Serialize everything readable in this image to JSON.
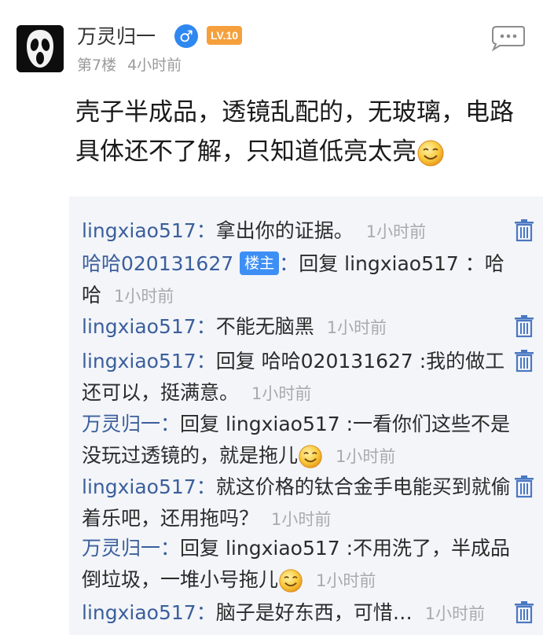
{
  "post": {
    "username": "万灵归一",
    "gender_symbol": "♂",
    "level": "LV.10",
    "floor": "第7楼",
    "time": "4小时前",
    "content": "壳子半成品，透镜乱配的，无玻璃，电路具体还不了解，只知道低亮太亮",
    "content_emoji": "smile-emoji",
    "avatar_icon": "scream-mask-icon",
    "reply_icon": "comment-bubble-icon"
  },
  "comments": [
    {
      "author": "lingxiao517",
      "text": "拿出你的证据。",
      "time": "1小时前",
      "deletable": true
    },
    {
      "author": "哈哈020131627",
      "badge": "楼主",
      "text": "回复 lingxiao517 ：哈哈",
      "time": "1小时前",
      "deletable": false
    },
    {
      "author": "lingxiao517",
      "text": "不能无脑黑",
      "time": "1小时前",
      "deletable": true
    },
    {
      "author": "lingxiao517",
      "text": "回复 哈哈020131627 :我的做工还可以，挺满意。",
      "time": "1小时前",
      "deletable": true
    },
    {
      "author": "万灵归一",
      "text": "回复 lingxiao517 :一看你们这些不是没玩过透镜的，就是拖儿",
      "time": "1小时前",
      "deletable": false,
      "emoji": "smile-emoji"
    },
    {
      "author": "lingxiao517",
      "text": "就这价格的钛合金手电能买到就偷着乐吧，还用拖吗？",
      "time": "1小时前",
      "deletable": true
    },
    {
      "author": "万灵归一",
      "text": "回复 lingxiao517 :不用洗了，半成品倒垃圾，一堆小号拖儿",
      "time": "1小时前",
      "deletable": false,
      "emoji": "smile-emoji"
    },
    {
      "author": "lingxiao517",
      "text": "脑子是好东西，可惜…",
      "time": "1小时前",
      "deletable": true
    }
  ],
  "colors": {
    "author_link": "#3b5f9c",
    "badge_blue": "#3d8ff5",
    "level_orange": "#f5a03c",
    "gender_blue": "#2f87f0",
    "trash_blue": "#4a78c2",
    "comment_bg": "#f3f5f9"
  }
}
